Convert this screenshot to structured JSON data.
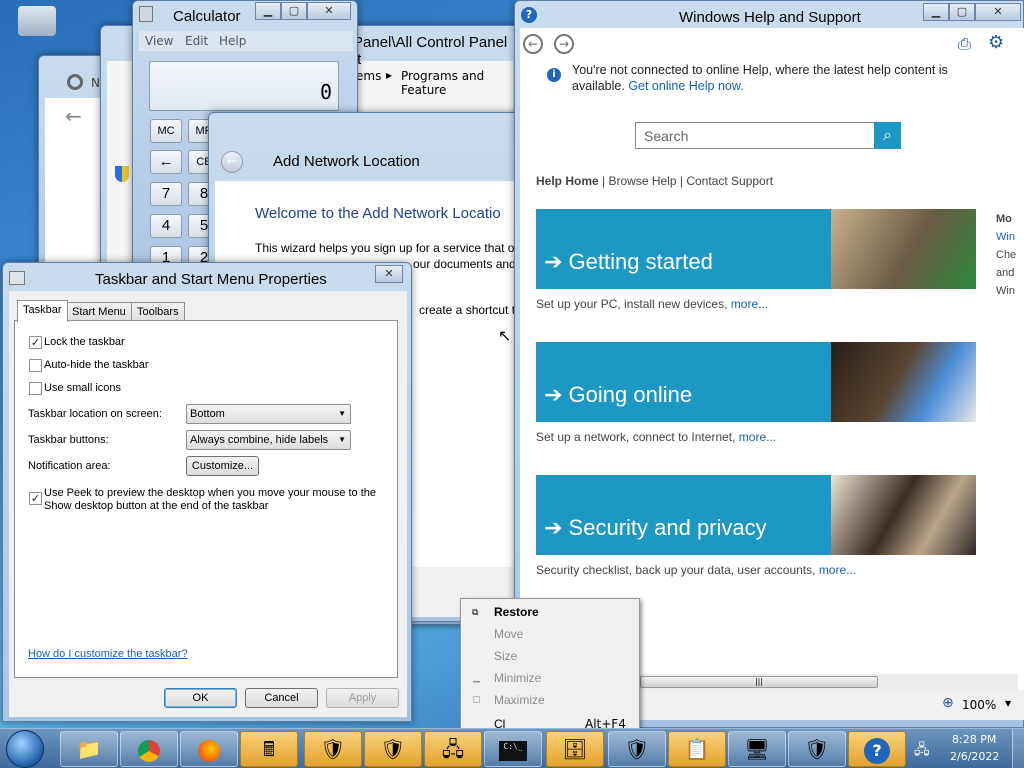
{
  "windows": {
    "calculator": {
      "title": "Calculator",
      "menu": [
        "View",
        "Edit",
        "Help"
      ],
      "display": "0",
      "buttons": [
        "MC",
        "MR",
        "←",
        "CE",
        "7",
        "8",
        "4",
        "5",
        "1",
        "2"
      ]
    },
    "explorer_bg": {
      "address_fragment": "Panel\\All Control Panel It",
      "breadcrumb": [
        "ems",
        "Programs and Feature"
      ]
    },
    "browser_bg": {
      "tab_letter": "N"
    },
    "add_network": {
      "title": "Add Network Location",
      "heading": "Welcome to the Add Network Locatio",
      "line1": "This wizard helps you sign up for a service that of",
      "line2": "our documents and",
      "line3": "create a shortcut t"
    },
    "taskbar_props": {
      "title": "Taskbar and Start Menu Properties",
      "tabs": [
        "Taskbar",
        "Start Menu",
        "Toolbars"
      ],
      "lock": {
        "label": "Lock the taskbar",
        "checked": "✓"
      },
      "autohide": {
        "label": "Auto-hide the taskbar",
        "checked": ""
      },
      "small": {
        "label": "Use small icons",
        "checked": ""
      },
      "location_label": "Taskbar location on screen:",
      "location_value": "Bottom",
      "buttons_label": "Taskbar buttons:",
      "buttons_value": "Always combine, hide labels",
      "notif_label": "Notification area:",
      "customize": "Customize...",
      "peek_line1": "Use Peek to preview the desktop when you move your mouse to the",
      "peek_line2": "Show desktop button at the end of the taskbar",
      "peek_checked": "✓",
      "help_link": "How do I customize the taskbar?",
      "ok": "OK",
      "cancel": "Cancel",
      "apply": "Apply"
    },
    "help": {
      "title": "Windows Help and Support",
      "notice": "You're not connected to online Help, where the latest help content is available.",
      "notice_link": "Get online Help now.",
      "search_placeholder": "Search",
      "nav": {
        "home": "Help Home",
        "browse": "Browse Help",
        "contact": "Contact Support",
        "sep": "|"
      },
      "tiles": [
        {
          "label": "➔ Getting started",
          "desc": "Set up your PC, install new devices,",
          "more": "more..."
        },
        {
          "label": "➔ Going online",
          "desc": "Set up a network, connect to Internet,",
          "more": "more..."
        },
        {
          "label": "➔ Security and privacy",
          "desc": "Security checklist, back up your data, user accounts,",
          "more": "more..."
        }
      ],
      "side": [
        "Mo",
        "Win",
        "Che",
        "and",
        "Win"
      ],
      "zoom": "100%"
    }
  },
  "context_menu": {
    "items": [
      "Restore",
      "Move",
      "Size",
      "Minimize",
      "Maximize",
      "Cl"
    ],
    "shortcut": "Alt+F4"
  },
  "taskbar": {
    "time": "8:28 PM",
    "date": "2/6/2022"
  },
  "colors": {
    "help_tile": "#1d97c4",
    "link": "#1a5fb4",
    "desktop": "#3f8fd6"
  }
}
